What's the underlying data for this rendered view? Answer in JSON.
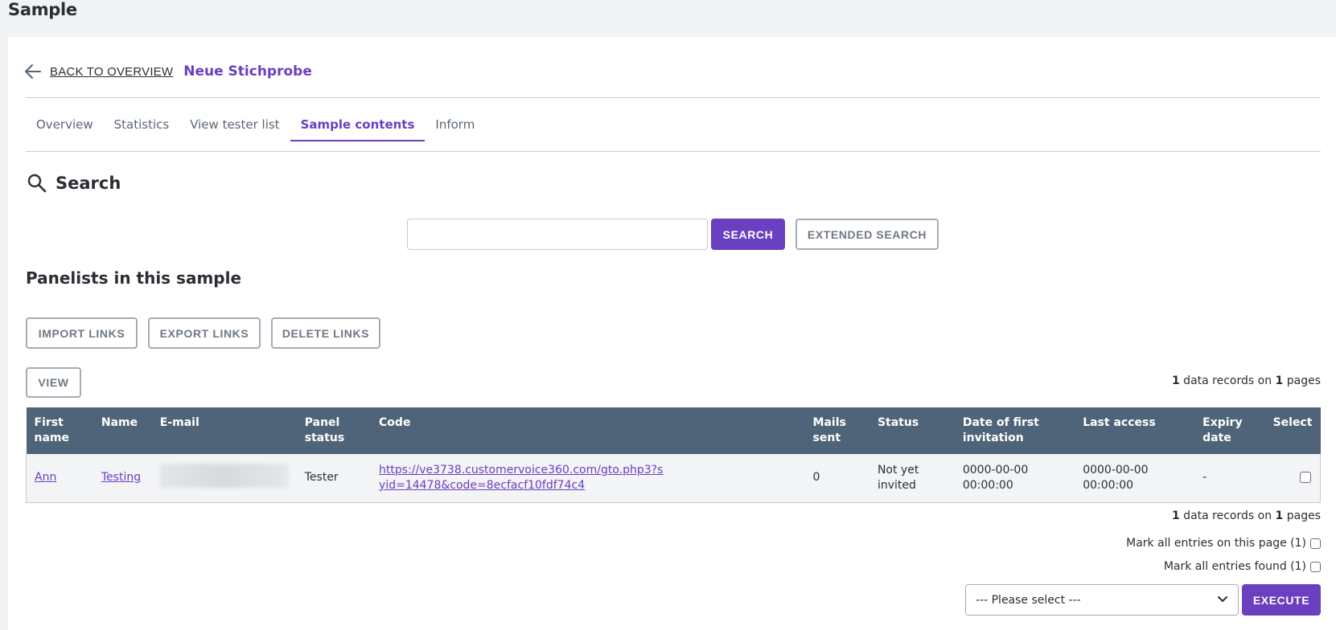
{
  "page": {
    "title": "Sample"
  },
  "breadcrumb": {
    "back_label": "BACK TO OVERVIEW",
    "current": "Neue Stichprobe"
  },
  "tabs": [
    {
      "label": "Overview",
      "active": false
    },
    {
      "label": "Statistics",
      "active": false
    },
    {
      "label": "View tester list",
      "active": false
    },
    {
      "label": "Sample contents",
      "active": true
    },
    {
      "label": "Inform",
      "active": false
    }
  ],
  "search": {
    "heading": "Search",
    "input_value": "",
    "search_button": "SEARCH",
    "extended_button": "EXTENDED SEARCH"
  },
  "panelists": {
    "title": "Panelists in this sample",
    "actions": {
      "import": "IMPORT LINKS",
      "export": "EXPORT LINKS",
      "delete": "DELETE LINKS",
      "view": "VIEW"
    },
    "records": {
      "count": "1",
      "middle": " data records on ",
      "pages": "1",
      "suffix": " pages"
    },
    "columns": [
      "First name",
      "Name",
      "E-mail",
      "Panel status",
      "Code",
      "Mails sent",
      "Status",
      "Date of first invitation",
      "Last access",
      "Expiry date",
      "Select"
    ],
    "rows": [
      {
        "first_name": "Ann",
        "name": "Testing",
        "email": "",
        "panel_status": "Tester",
        "code": "https://ve3738.customervoice360.com/gto.php3?syid=14478&code=8ecfacf10fdf74c4",
        "mails_sent": "0",
        "status": "Not yet invited",
        "first_invitation": "0000-00-00 00:00:00",
        "last_access": "0000-00-00 00:00:00",
        "expiry_date": "-"
      }
    ],
    "mark_page": "Mark all entries on this page (1)",
    "mark_found": "Mark all entries found (1)",
    "select_placeholder": "--- Please select ---",
    "execute": "EXECUTE"
  },
  "colors": {
    "accent": "#6a3fc0",
    "table_header": "#4f6478",
    "outline": "#a4acb6"
  }
}
